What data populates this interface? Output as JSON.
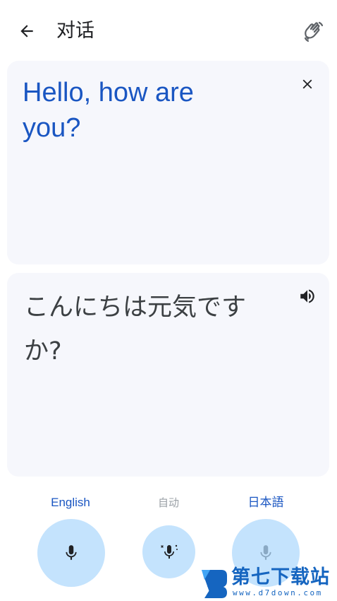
{
  "header": {
    "title": "对话",
    "back_icon": "arrow-back-icon",
    "wave_icon": "waving-hand-icon"
  },
  "source_card": {
    "text": "Hello, how are you?",
    "close_icon": "close-icon",
    "text_color": "#1a56c2"
  },
  "target_card": {
    "text": "こんにちは元気ですか?",
    "speaker_icon": "volume-up-icon"
  },
  "languages": {
    "left": "English",
    "center": "自动",
    "right": "日本語"
  },
  "mics": {
    "left_icon": "mic-icon",
    "center_icon": "auto-mic-icon",
    "right_icon": "mic-icon",
    "accent_color": "#c4e3fd"
  },
  "watermark": {
    "name": "第七下载站",
    "url": "www.d7down.com"
  }
}
